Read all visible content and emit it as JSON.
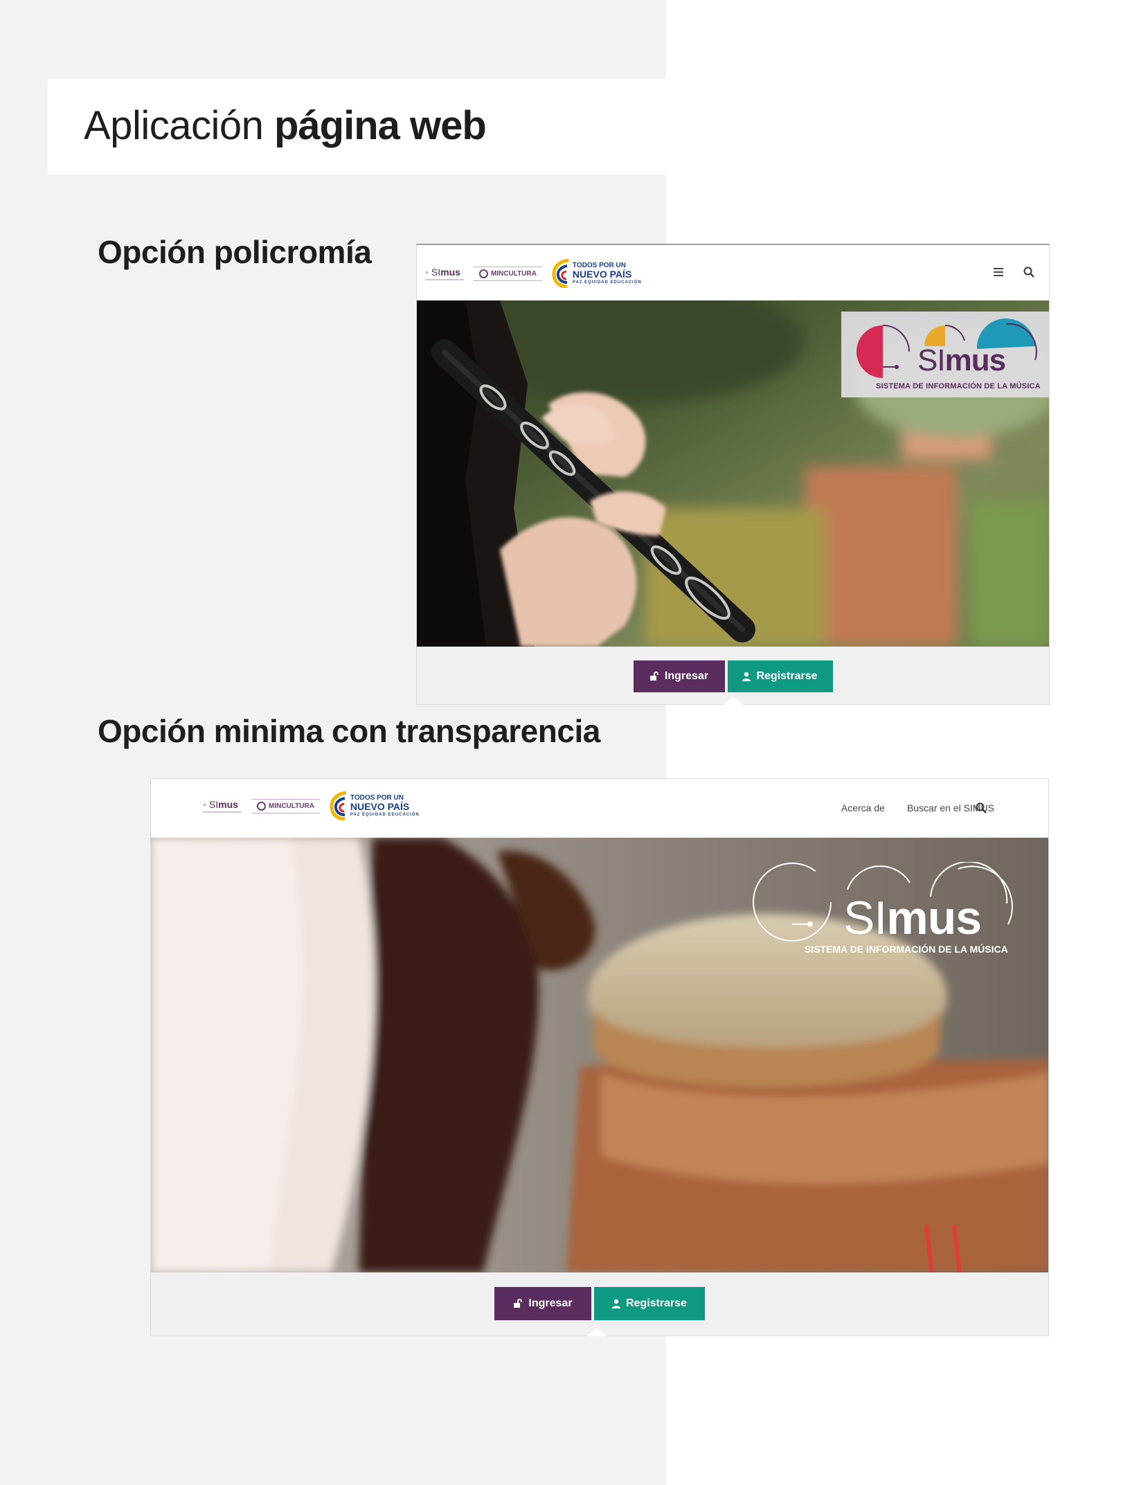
{
  "page": {
    "title_light": "Aplicación",
    "title_bold": "página web",
    "section_1": "Opción policromía",
    "section_2": "Opción minima con transparencia"
  },
  "logos": {
    "simus_si": "SI",
    "simus_mus": "mus",
    "mincultura": "MINCULTURA",
    "nuevo_line1": "TODOS POR UN",
    "nuevo_line2": "NUEVO PAÍS",
    "nuevo_line3": "PAZ  EQUIDAD  EDUCACIÓN"
  },
  "hero_logo": {
    "si": "SI",
    "mus": "mus",
    "caption": "SISTEMA DE INFORMACIÓN DE LA MÚSICA"
  },
  "option_1": {
    "nav_icons": [
      "menu-icon",
      "search-icon"
    ],
    "hero_image": "clarinet player photo",
    "login_label": "Ingresar",
    "register_label": "Registrarse"
  },
  "option_2": {
    "nav_links": [
      "Acerca de",
      "Buscar en el SIMUS"
    ],
    "nav_icons": [
      "search-icon"
    ],
    "hero_image": "drummer hands on drum photo",
    "login_label": "Ingresar",
    "register_label": "Registrarse"
  },
  "colors": {
    "purple": "#5b2c5e",
    "teal": "#0e9a82",
    "logo_red": "#d62a55",
    "logo_yellow": "#eba92c",
    "logo_cyan": "#1e9ab8"
  }
}
